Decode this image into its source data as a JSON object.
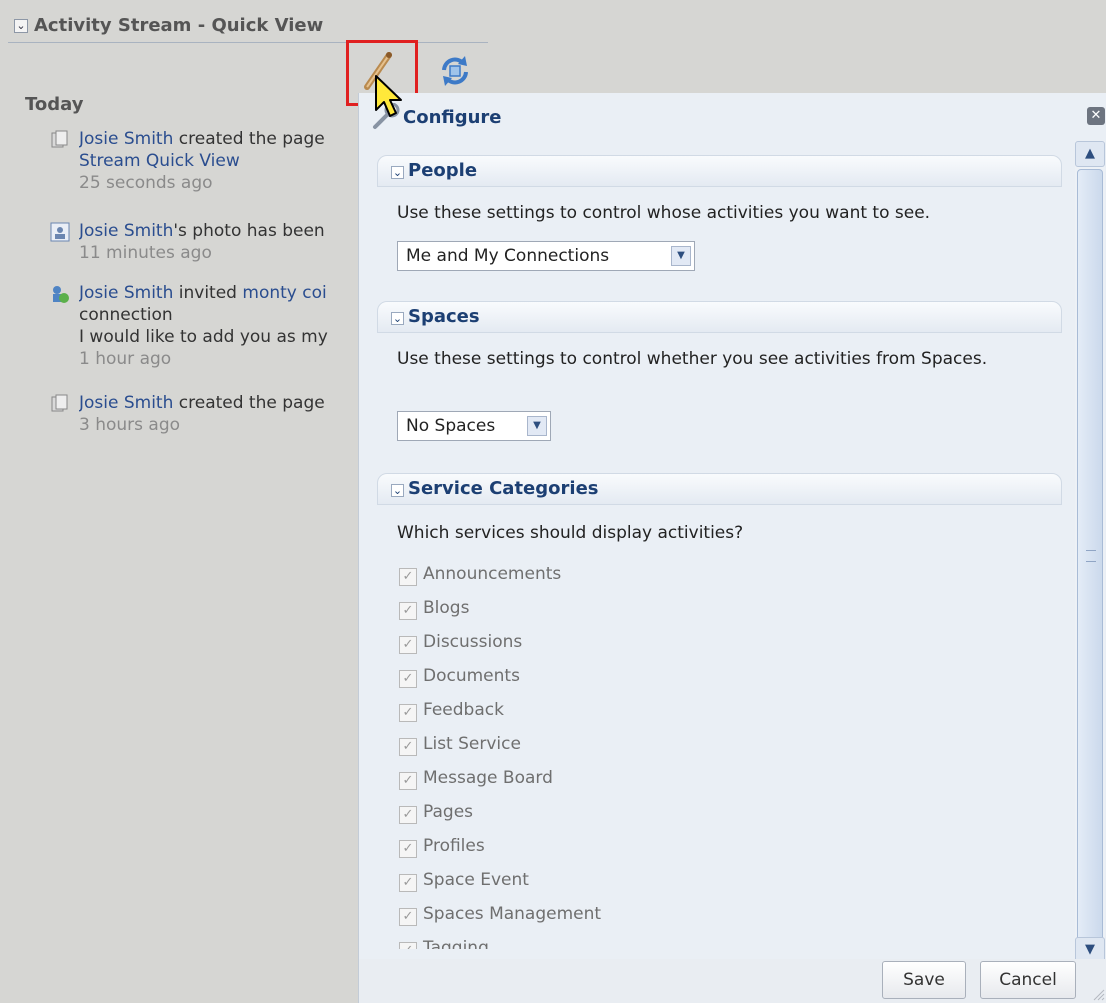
{
  "portlet": {
    "title": "Activity Stream - Quick View",
    "today_heading": "Today",
    "activities": [
      {
        "icon": "page-icon",
        "lines": [
          {
            "segments": [
              {
                "text": "Josie Smith",
                "link": true
              },
              {
                "text": " created the page",
                "link": false
              }
            ]
          },
          {
            "segments": [
              {
                "text": "Stream Quick View",
                "link": true
              }
            ]
          },
          {
            "segments": [
              {
                "text": "25 seconds ago",
                "muted": true
              }
            ]
          }
        ]
      },
      {
        "icon": "profile-photo-icon",
        "lines": [
          {
            "segments": [
              {
                "text": "Josie Smith",
                "link": true
              },
              {
                "text": "'s photo has been",
                "link": false
              }
            ]
          },
          {
            "segments": [
              {
                "text": "11 minutes ago",
                "muted": true
              }
            ]
          }
        ]
      },
      {
        "icon": "invite-connection-icon",
        "lines": [
          {
            "segments": [
              {
                "text": "Josie Smith",
                "link": true
              },
              {
                "text": " invited ",
                "link": false
              },
              {
                "text": "monty coi",
                "link": true
              }
            ]
          },
          {
            "segments": [
              {
                "text": "connection"
              }
            ]
          },
          {
            "segments": [
              {
                "text": "I would like to add you as my"
              }
            ]
          },
          {
            "segments": [
              {
                "text": "1 hour ago",
                "muted": true
              }
            ]
          }
        ]
      },
      {
        "icon": "page-icon",
        "lines": [
          {
            "segments": [
              {
                "text": "Josie Smith",
                "link": true
              },
              {
                "text": " created the page",
                "link": false
              }
            ]
          },
          {
            "segments": [
              {
                "text": "3 hours ago",
                "muted": true
              }
            ]
          }
        ]
      }
    ]
  },
  "dialog": {
    "title": "Configure",
    "people": {
      "title": "People",
      "description": "Use these settings to control whose activities you want to see.",
      "selected": "Me and My Connections"
    },
    "spaces": {
      "title": "Spaces",
      "description": "Use these settings to control whether you see activities from Spaces.",
      "selected": "No Spaces"
    },
    "services": {
      "title": "Service Categories",
      "description": "Which services should display activities?",
      "items": [
        "Announcements",
        "Blogs",
        "Discussions",
        "Documents",
        "Feedback",
        "List Service",
        "Message Board",
        "Pages",
        "Profiles",
        "Space Event",
        "Spaces Management",
        "Tagging"
      ]
    },
    "save_label": "Save",
    "cancel_label": "Cancel"
  },
  "colors": {
    "link": "#2a4d8f",
    "highlight_box": "#e02020",
    "section_title": "#1c3f73"
  }
}
